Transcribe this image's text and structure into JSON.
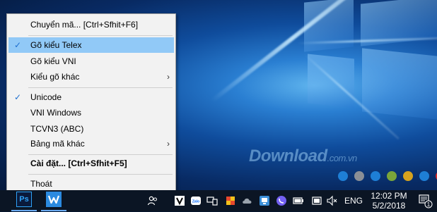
{
  "menu": {
    "items": [
      {
        "label": "Chuyển mã... [Ctrl+Sfhit+F6]",
        "checked": false,
        "submenu": false,
        "bold": false,
        "highlighted": false
      },
      {
        "label": "Gõ kiểu Telex",
        "checked": true,
        "submenu": false,
        "bold": false,
        "highlighted": true
      },
      {
        "label": "Gõ kiểu VNI",
        "checked": false,
        "submenu": false,
        "bold": false,
        "highlighted": false
      },
      {
        "label": "Kiểu gõ khác",
        "checked": false,
        "submenu": true,
        "bold": false,
        "highlighted": false
      },
      {
        "label": "Unicode",
        "checked": true,
        "submenu": false,
        "bold": false,
        "highlighted": false
      },
      {
        "label": "VNI Windows",
        "checked": false,
        "submenu": false,
        "bold": false,
        "highlighted": false
      },
      {
        "label": "TCVN3 (ABC)",
        "checked": false,
        "submenu": false,
        "bold": false,
        "highlighted": false
      },
      {
        "label": "Bảng mã khác",
        "checked": false,
        "submenu": true,
        "bold": false,
        "highlighted": false
      },
      {
        "label": "Cài đặt... [Ctrl+Sfhit+F5]",
        "checked": false,
        "submenu": false,
        "bold": true,
        "highlighted": false
      },
      {
        "label": "Thoát",
        "checked": false,
        "submenu": false,
        "bold": false,
        "highlighted": false
      }
    ],
    "check_glyph": "✓",
    "arrow_glyph": "›"
  },
  "watermark": {
    "text": "Download",
    "suffix": ".com.vn",
    "dot_colors": [
      "#1e7fd6",
      "#8a8f96",
      "#1e7fd6",
      "#7aa53a",
      "#d6a21e",
      "#1e7fd6",
      "#d62a2a"
    ]
  },
  "taskbar": {
    "apps": [
      {
        "name": "photoshop",
        "text": "Ps"
      },
      {
        "name": "wps-writer",
        "text": "W"
      }
    ],
    "tray_icons": [
      "people-icon",
      "vietkey-v-icon",
      "zalo-icon",
      "devices-icon",
      "shield-icon",
      "onedrive-icon",
      "network-monitor-icon",
      "unikey-icon",
      "viber-icon",
      "battery-icon",
      "display-icon",
      "volume-muted-icon"
    ],
    "language": "ENG",
    "time": "12:02 PM",
    "date": "5/2/2018",
    "notification_count": "1"
  }
}
